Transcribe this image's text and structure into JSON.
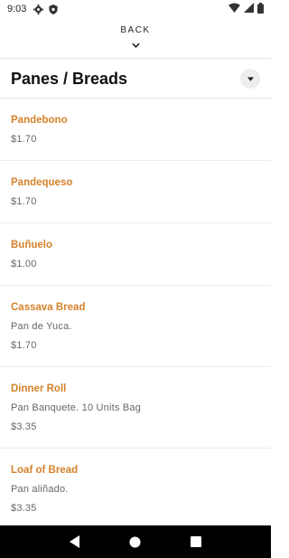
{
  "status_bar": {
    "time": "9:03"
  },
  "nav": {
    "back_label": "BACK"
  },
  "category": {
    "title": "Panes / Breads"
  },
  "items": [
    {
      "name": "Pandebono",
      "description": "",
      "price": "$1.70"
    },
    {
      "name": "Pandequeso",
      "description": "",
      "price": "$1.70"
    },
    {
      "name": "Buñuelo",
      "description": "",
      "price": "$1.00"
    },
    {
      "name": "Cassava Bread",
      "description": "Pan de Yuca.",
      "price": "$1.70"
    },
    {
      "name": "Dinner Roll",
      "description": "Pan Banquete. 10 Units Bag",
      "price": "$3.35"
    },
    {
      "name": "Loaf of Bread",
      "description": "Pan aliñado.",
      "price": "$3.35"
    }
  ],
  "colors": {
    "accent": "#d4822a",
    "text_secondary": "#666666",
    "navbar": "#000000"
  },
  "icons": {
    "status": [
      "gear-icon",
      "shield-icon",
      "wifi-icon",
      "signal-icon",
      "battery-icon"
    ],
    "navigation": [
      "back-triangle-icon",
      "home-circle-icon",
      "recents-square-icon"
    ]
  }
}
